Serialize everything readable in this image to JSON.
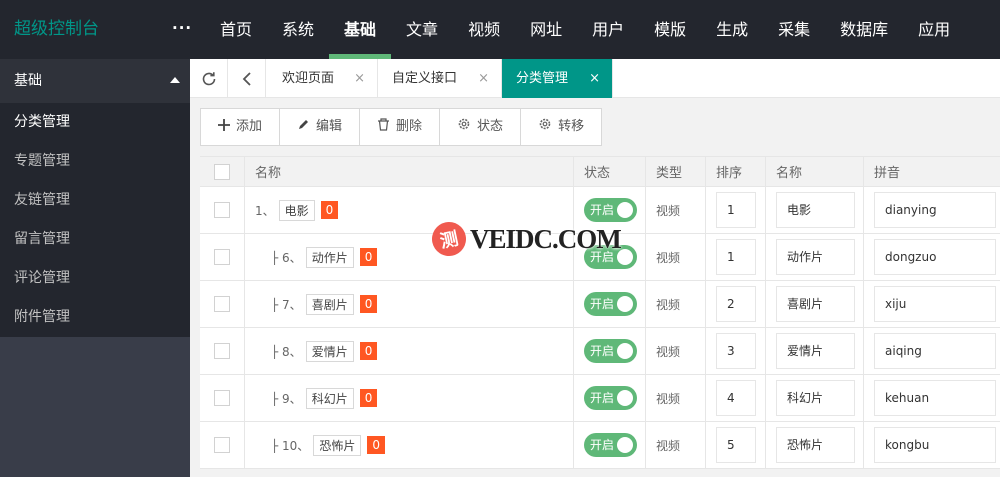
{
  "app": {
    "logo": "超级控制台",
    "more": "···"
  },
  "topnav": {
    "items": [
      "首页",
      "系统",
      "基础",
      "文章",
      "视频",
      "网址",
      "用户",
      "模版",
      "生成",
      "采集",
      "数据库",
      "应用"
    ],
    "active_index": 2
  },
  "sidebar": {
    "title": "基础",
    "items": [
      "分类管理",
      "专题管理",
      "友链管理",
      "留言管理",
      "评论管理",
      "附件管理"
    ],
    "active_index": 0
  },
  "tabs": {
    "items": [
      {
        "label": "欢迎页面",
        "close": "×"
      },
      {
        "label": "自定义接口",
        "close": "×"
      },
      {
        "label": "分类管理",
        "close": "×"
      }
    ],
    "active_index": 2
  },
  "toolbar": {
    "add": "添加",
    "edit": "编辑",
    "delete": "删除",
    "status": "状态",
    "move": "转移"
  },
  "table": {
    "headers": {
      "name": "名称",
      "status": "状态",
      "type": "类型",
      "order": "排序",
      "name2": "名称",
      "pinyin": "拼音"
    },
    "rows": [
      {
        "prefix": "1、",
        "name": "电影",
        "count": "0",
        "status": "开启",
        "type": "视频",
        "order": "1",
        "name2": "电影",
        "pinyin": "dianying"
      },
      {
        "prefix": "├ 6、",
        "name": "动作片",
        "count": "0",
        "status": "开启",
        "type": "视频",
        "order": "1",
        "name2": "动作片",
        "pinyin": "dongzuo"
      },
      {
        "prefix": "├ 7、",
        "name": "喜剧片",
        "count": "0",
        "status": "开启",
        "type": "视频",
        "order": "2",
        "name2": "喜剧片",
        "pinyin": "xiju"
      },
      {
        "prefix": "├ 8、",
        "name": "爱情片",
        "count": "0",
        "status": "开启",
        "type": "视频",
        "order": "3",
        "name2": "爱情片",
        "pinyin": "aiqing"
      },
      {
        "prefix": "├ 9、",
        "name": "科幻片",
        "count": "0",
        "status": "开启",
        "type": "视频",
        "order": "4",
        "name2": "科幻片",
        "pinyin": "kehuan"
      },
      {
        "prefix": "├ 10、",
        "name": "恐怖片",
        "count": "0",
        "status": "开启",
        "type": "视频",
        "order": "5",
        "name2": "恐怖片",
        "pinyin": "kongbu"
      }
    ]
  },
  "watermark": {
    "seal": "测",
    "text": "VEIDC.COM"
  },
  "colors": {
    "accent": "#009688",
    "switch_on": "#5fb878",
    "badge": "#ff5722",
    "topbar": "#23262e"
  }
}
